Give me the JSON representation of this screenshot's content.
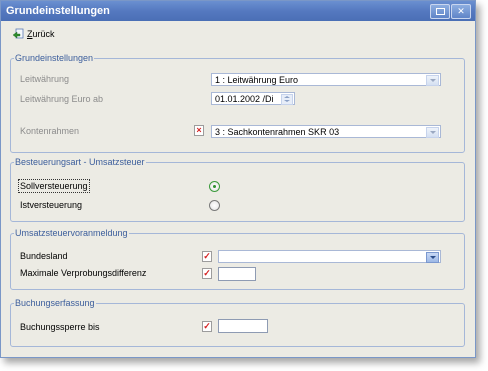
{
  "window": {
    "title": "Grundeinstellungen"
  },
  "toolbar": {
    "back_label": "Zurück",
    "back_mnemonic": "Z",
    "back_rest": "urück"
  },
  "grund": {
    "title": "Grundeinstellungen",
    "leitwaehrung_label": "Leitwährung",
    "leitwaehrung_value": "1 : Leitwährung Euro",
    "euro_ab_label": "Leitwährung Euro ab",
    "euro_ab_value": "01.01.2002 /Di",
    "kontenrahmen_label": "Kontenrahmen",
    "kontenrahmen_value": "3 : Sachkontenrahmen SKR 03"
  },
  "besteuerung": {
    "title": "Besteuerungsart - Umsatzsteuer",
    "soll_label": "Sollversteuerung",
    "soll_checked": true,
    "ist_label": "Istversteuerung",
    "ist_checked": false
  },
  "voranmeldung": {
    "title": "Umsatzsteuervoranmeldung",
    "bundesland_label": "Bundesland",
    "bundesland_value": "",
    "differenz_label": "Maximale Verprobungsdifferenz",
    "differenz_value": ""
  },
  "buchung": {
    "title": "Buchungserfassung",
    "sperre_label": "Buchungssperre bis",
    "sperre_value": ""
  },
  "colors": {
    "titlebar": "#5579c0",
    "group_title": "#3c5e9c",
    "panel": "#ecebe4",
    "radio_selected": "#2f8f2f"
  }
}
